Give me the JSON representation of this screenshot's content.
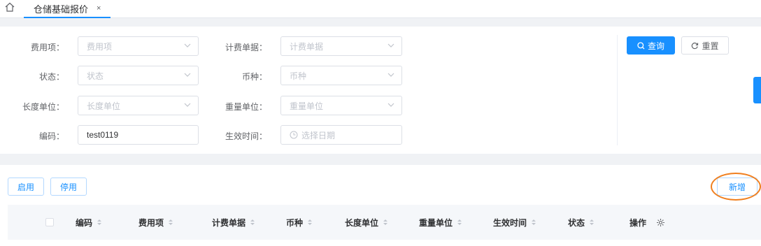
{
  "tabbar": {
    "active_tab": "仓储基础报价",
    "close_glyph": "×"
  },
  "filters": {
    "fee_item": {
      "label": "费用项：",
      "placeholder": "费用项"
    },
    "billing_doc": {
      "label": "计费单据：",
      "placeholder": "计费单据"
    },
    "status": {
      "label": "状态：",
      "placeholder": "状态"
    },
    "currency": {
      "label": "币种：",
      "placeholder": "币种"
    },
    "length_unit": {
      "label": "长度单位：",
      "placeholder": "长度单位"
    },
    "weight_unit": {
      "label": "重量单位：",
      "placeholder": "重量单位"
    },
    "code": {
      "label": "编码：",
      "value": "test0119"
    },
    "effective_time": {
      "label": "生效时间：",
      "placeholder": "选择日期"
    }
  },
  "actions": {
    "search": "查询",
    "reset": "重置"
  },
  "toolbar": {
    "enable": "启用",
    "disable": "停用",
    "add": "新增"
  },
  "table": {
    "columns": [
      "编码",
      "费用项",
      "计费单据",
      "币种",
      "长度单位",
      "重量单位",
      "生效时间",
      "状态",
      "操作"
    ]
  },
  "colors": {
    "primary": "#1890ff",
    "annotation": "#f07f1f"
  }
}
